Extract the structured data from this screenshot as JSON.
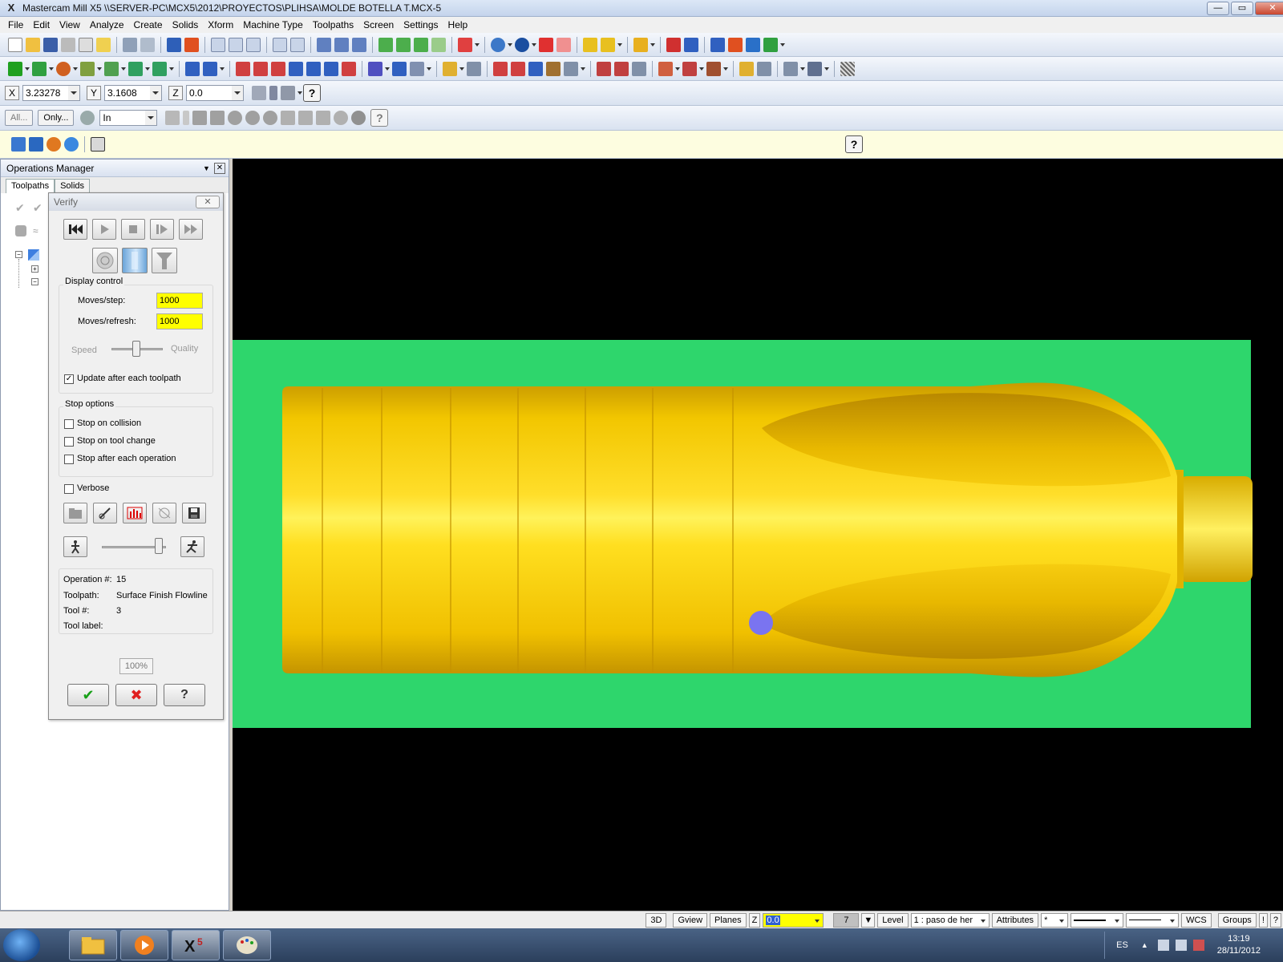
{
  "window": {
    "title": "Mastercam Mill X5  \\\\SERVER-PC\\MCX5\\2012\\PROYECTOS\\PLIHSA\\MOLDE BOTELLA T.MCX-5",
    "minimize": "—",
    "maximize": "▭",
    "close": "✕"
  },
  "menu": [
    "File",
    "Edit",
    "View",
    "Analyze",
    "Create",
    "Solids",
    "Xform",
    "Machine Type",
    "Toolpaths",
    "Screen",
    "Settings",
    "Help"
  ],
  "coords": {
    "x_label": "X",
    "x_value": "3.23278",
    "y_label": "Y",
    "y_value": "3.1608",
    "z_label": "Z",
    "z_value": "0.0",
    "help": "?"
  },
  "selection_bar": {
    "all_label": "All...",
    "only_label": "Only...",
    "mode_value": "In",
    "help": "?"
  },
  "view_bar_help": "?",
  "ops_manager": {
    "title": "Operations Manager",
    "tabs": [
      "Toolpaths",
      "Solids"
    ],
    "close": "✕"
  },
  "verify": {
    "title": "Verify",
    "close": "✕",
    "display_control_label": "Display control",
    "moves_step_label": "Moves/step:",
    "moves_step_value": "1000",
    "moves_refresh_label": "Moves/refresh:",
    "moves_refresh_value": "1000",
    "speed_label": "Speed",
    "quality_label": "Quality",
    "update_label": "Update after each toolpath",
    "update_checked": true,
    "stop_options_label": "Stop options",
    "stop_collision_label": "Stop on collision",
    "stop_tool_change_label": "Stop on tool change",
    "stop_after_op_label": "Stop after each operation",
    "verbose_label": "Verbose",
    "operation_label": "Operation #:",
    "operation_value": "15",
    "toolpath_label": "Toolpath:",
    "toolpath_value": "Surface Finish Flowline",
    "tool_label": "Tool #:",
    "tool_value": "3",
    "tool_name_label": "Tool label:",
    "tool_name_value": "",
    "percent": "100%",
    "ok": "✔",
    "cancel": "✖",
    "help": "?"
  },
  "status_bar": {
    "mode_3d": "3D",
    "gview": "Gview",
    "planes": "Planes",
    "z_label": "Z",
    "z_value": "0.0",
    "color_value": "7",
    "level_label": "Level",
    "level_value": "1 : paso de her",
    "attributes": "Attributes",
    "point_style": "*",
    "wcs": "WCS",
    "groups": "Groups",
    "bang": "!",
    "help": "?"
  },
  "taskbar": {
    "lang": "ES",
    "time": "13:19",
    "date": "28/11/2012"
  },
  "colors": {
    "stock_green": "#2fd86a",
    "part_yellow": "#f2c500",
    "tool_blue": "#7a74f0",
    "viewport_bg": "#000000",
    "input_yellow": "#ffff00"
  }
}
